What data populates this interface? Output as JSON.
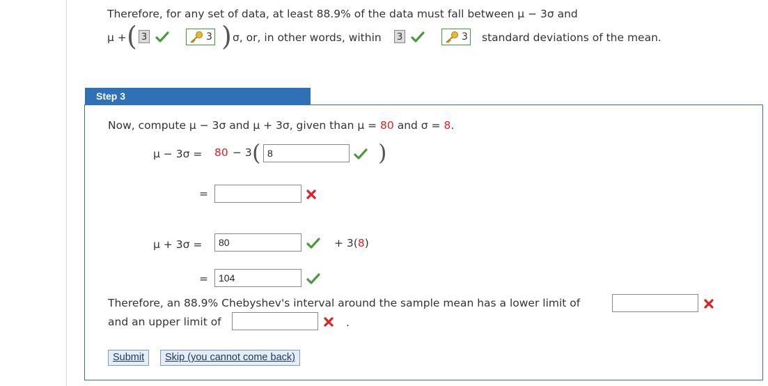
{
  "intro": {
    "line1": "Therefore, for any set of data, at least 88.9% of the data must fall between μ − 3σ and",
    "mu_plus": "μ +",
    "lower_k": "3",
    "key_value_1": "3",
    "sigma_text": "σ, or, in other words, within",
    "within_k": "3",
    "key_value_2": "3",
    "std_text": "standard deviations of the mean."
  },
  "step": {
    "title": "Step 3",
    "compute_prefix": "Now, compute μ − 3σ and μ + 3σ, given than μ =",
    "mu_value": "80",
    "and_sigma": "and σ =",
    "sigma_value": "8",
    "period": ".",
    "eq1": {
      "lhs": "μ − 3σ =",
      "mu": "80",
      "minus_three": "− 3",
      "input_value": "8"
    },
    "eq1_result": {
      "equals": "=",
      "input_value": ""
    },
    "eq2": {
      "lhs": "μ + 3σ =",
      "input_value": "80",
      "suffix_pre": "+ 3(",
      "suffix_sigma": "8",
      "suffix_post": ")"
    },
    "eq2_result": {
      "equals": "=",
      "input_value": "104"
    },
    "conclusion": {
      "text1": "Therefore, an 88.9% Chebyshev's interval around the sample mean has a lower limit of",
      "lower_value": "",
      "text2": "and an upper limit of",
      "upper_value": "",
      "period": "."
    },
    "buttons": {
      "submit": "Submit",
      "skip": "Skip (you cannot come back)"
    }
  },
  "colors": {
    "header_blue": "#2f70b7",
    "correct_green": "#4a9a3a",
    "incorrect_red": "#e02020",
    "given_value_red": "#e02020"
  },
  "icons": [
    "check-icon",
    "cross-icon",
    "key-icon"
  ]
}
